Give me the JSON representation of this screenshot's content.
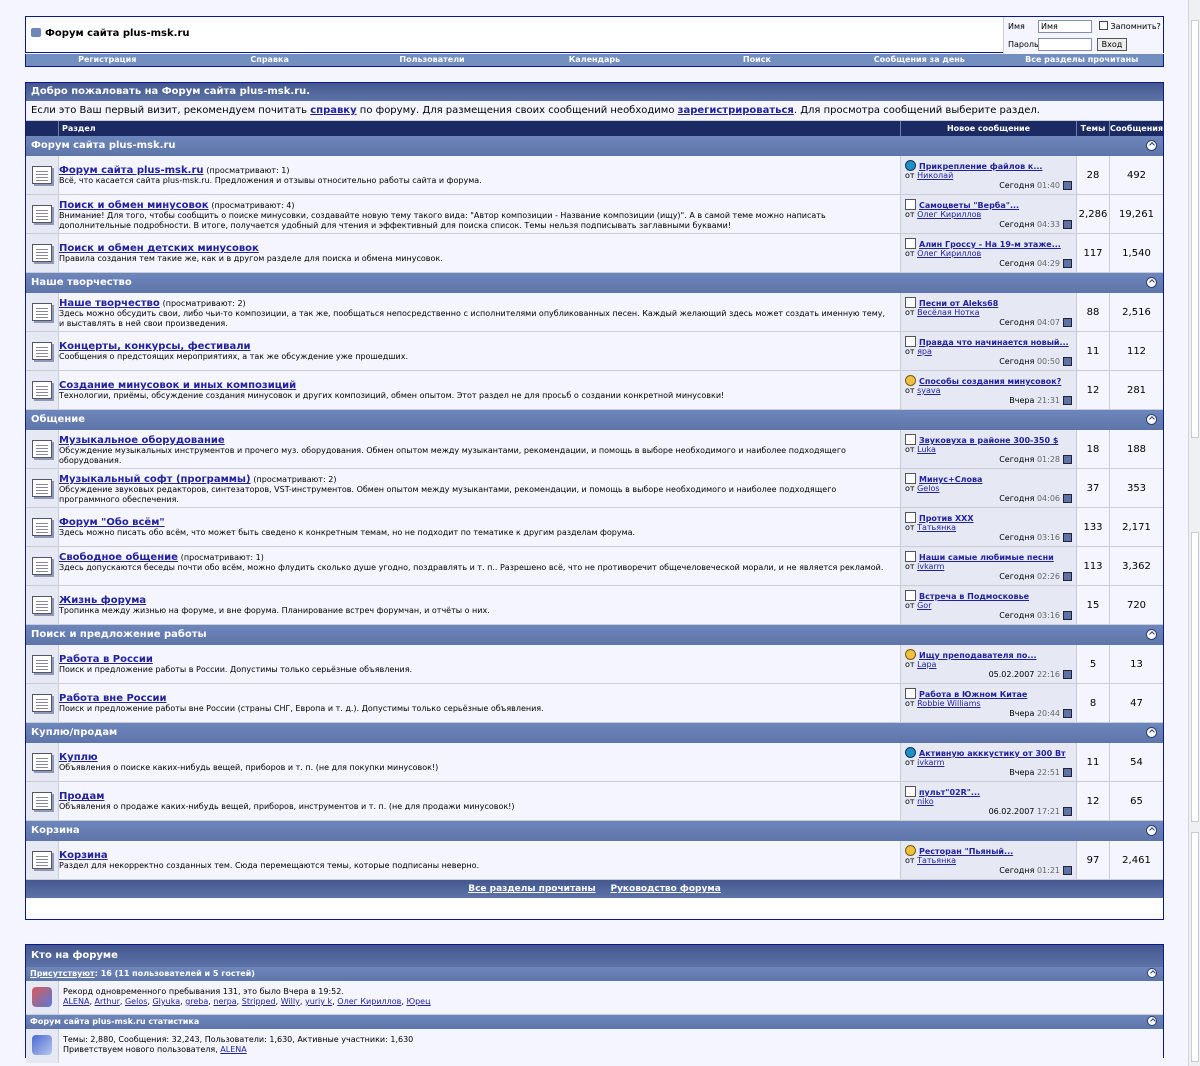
{
  "header": {
    "logo_text": "Форум сайта plus-msk.ru",
    "login": {
      "user_label": "Имя",
      "user_value": "Имя",
      "pass_label": "Пароль",
      "remember_label": "Запомнить?",
      "submit_label": "Вход"
    }
  },
  "navbar": [
    "Регистрация",
    "Справка",
    "Пользователи",
    "Календарь",
    "Поиск",
    "Сообщения за день",
    "Все разделы прочитаны"
  ],
  "welcome": {
    "title": "Добро пожаловать на Форум сайта plus-msk.ru.",
    "text_1": "Если это Ваш первый визит, рекомендуем почитать ",
    "link_help": "справку",
    "text_2": " по форуму. Для размещения своих сообщений необходимо ",
    "link_register": "зарегистрироваться",
    "text_3": ". Для просмотра сообщений выберите раздел."
  },
  "columns": {
    "forum": "Раздел",
    "last": "Новое сообщение",
    "threads": "Темы",
    "posts": "Сообщения"
  },
  "categories": [
    {
      "title": "Форум сайта plus-msk.ru",
      "forums": [
        {
          "name": "Форум сайта plus-msk.ru",
          "viewing": "(просматривают: 1)",
          "desc": "Всё, что касается сайта plus-msk.ru. Предложения и отзывы относительно работы сайта и форума.",
          "last_title": "Прикрепление файлов к...",
          "last_icon": "question",
          "by_label": "от",
          "last_user": "Николай",
          "date": "Сегодня",
          "time": "01:40",
          "threads": "28",
          "posts": "492"
        },
        {
          "name": "Поиск и обмен минусовок",
          "viewing": "(просматривают: 4)",
          "desc": "Внимание! Для того, чтобы сообщить о поиске минусовки, создавайте новую тему такого вида: \"Автор композиции - Название композиции (ищу)\". А в самой теме можно написать дополнительные подробности. В итоге, получается удобный для чтения и эффективный для поиска список. Темы нельзя подписывать заглавными буквами!",
          "last_title": "Самоцветы \"Верба\"...",
          "last_icon": "doc",
          "by_label": "от",
          "last_user": "Олег Кириллов",
          "date": "Сегодня",
          "time": "04:33",
          "threads": "2,286",
          "posts": "19,261"
        },
        {
          "name": "Поиск и обмен детских минусовок",
          "viewing": "",
          "desc": "Правила создания тем такие же, как и в другом разделе для поиска и обмена минусовок.",
          "last_title": "Алин Гроссу - На 19-м этаже...",
          "last_icon": "doc",
          "by_label": "от",
          "last_user": "Олег Кириллов",
          "date": "Сегодня",
          "time": "04:29",
          "threads": "117",
          "posts": "1,540"
        }
      ]
    },
    {
      "title": "Наше творчество",
      "forums": [
        {
          "name": "Наше творчество",
          "viewing": "(просматривают: 2)",
          "desc": "Здесь можно обсудить свои, либо чьи-то композиции, а так же, пообщаться непосредственно с исполнителями опубликованных песен. Каждый желающий здесь может создать именную тему, и выставлять в ней свои произведения.",
          "last_title": "Песни от Aleks68",
          "last_icon": "doc",
          "by_label": "от",
          "last_user": "Весёлая Нотка",
          "date": "Сегодня",
          "time": "04:07",
          "threads": "88",
          "posts": "2,516"
        },
        {
          "name": "Концерты, конкурсы, фестивали",
          "viewing": "",
          "desc": "Сообщения о предстоящих мероприятиях, а так же обсуждение уже прошедших.",
          "last_title": "Правда что начинается новый...",
          "last_icon": "doc",
          "by_label": "от",
          "last_user": "яра",
          "date": "Сегодня",
          "time": "00:50",
          "threads": "11",
          "posts": "112"
        },
        {
          "name": "Создание минусовок и иных композиций",
          "viewing": "",
          "desc": "Технологии, приёмы, обсуждение создания минусовок и других композиций, обмен опытом. Этот раздел не для просьб о создании конкретной минусовки!",
          "last_title": "Способы создания минусовок?",
          "last_icon": "smile",
          "by_label": "от",
          "last_user": "syava",
          "date": "Вчера",
          "time": "21:31",
          "threads": "12",
          "posts": "281"
        }
      ]
    },
    {
      "title": "Общение",
      "forums": [
        {
          "name": "Музыкальное оборудование",
          "viewing": "",
          "desc": "Обсуждение музыкальных инструментов и прочего муз. оборудования. Обмен опытом между музыкантами, рекомендации, и помощь в выборе необходимого и наиболее подходящего оборудования.",
          "last_title": "Звуковуха в районе 300-350 $",
          "last_icon": "doc",
          "by_label": "от",
          "last_user": "Luka",
          "date": "Сегодня",
          "time": "01:28",
          "threads": "18",
          "posts": "188"
        },
        {
          "name": "Музыкальный софт (программы)",
          "viewing": "(просматривают: 2)",
          "desc": "Обсуждение звуковых редакторов, синтезаторов, VST-инструментов. Обмен опытом между музыкантами, рекомендации, и помощь в выборе необходимого и наиболее подходящего программного обеспечения.",
          "last_title": "Минус+Слова",
          "last_icon": "doc",
          "by_label": "от",
          "last_user": "Gelos",
          "date": "Сегодня",
          "time": "04:06",
          "threads": "37",
          "posts": "353"
        },
        {
          "name": "Форум \"Обо всём\"",
          "viewing": "",
          "desc": "Здесь можно писать обо всём, что может быть сведено к конкретным темам, но не подходит по тематике к другим разделам форума.",
          "last_title": "Против XXX",
          "last_icon": "doc",
          "by_label": "от",
          "last_user": "Татьянка",
          "date": "Сегодня",
          "time": "03:16",
          "threads": "133",
          "posts": "2,171"
        },
        {
          "name": "Свободное общение",
          "viewing": "(просматривают: 1)",
          "desc": "Здесь допускаются беседы почти обо всём, можно флудить сколько душе угодно, поздравлять и т. п.. Разрешено всё, что не противоречит общечеловеческой морали, и не является рекламой.",
          "last_title": "Наши самые любимые песни",
          "last_icon": "doc",
          "by_label": "от",
          "last_user": "ivkarm",
          "date": "Сегодня",
          "time": "02:26",
          "threads": "113",
          "posts": "3,362"
        },
        {
          "name": "Жизнь форума",
          "viewing": "",
          "desc": "Тропинка между жизнью на форуме, и вне форума. Планирование встреч форумчан, и отчёты о них.",
          "last_title": "Встреча в Подмосковье",
          "last_icon": "doc",
          "by_label": "от",
          "last_user": "Gor",
          "date": "Сегодня",
          "time": "03:16",
          "threads": "15",
          "posts": "720"
        }
      ]
    },
    {
      "title": "Поиск и предложение работы",
      "forums": [
        {
          "name": "Работа в России",
          "viewing": "",
          "desc": "Поиск и предложение работы в России. Допустимы только серьёзные объявления.",
          "last_title": "Ищу преподавателя по...",
          "last_icon": "smile",
          "by_label": "от",
          "last_user": "Lapa",
          "date": "05.02.2007",
          "time": "22:16",
          "threads": "5",
          "posts": "13"
        },
        {
          "name": "Работа вне России",
          "viewing": "",
          "desc": "Поиск и предложение работы вне России (страны СНГ, Европа и т. д.). Допустимы только серьёзные объявления.",
          "last_title": "Работа в Южном Китае",
          "last_icon": "doc",
          "by_label": "от",
          "last_user": "Robbie Williams",
          "date": "Вчера",
          "time": "20:44",
          "threads": "8",
          "posts": "47"
        }
      ]
    },
    {
      "title": "Куплю/продам",
      "forums": [
        {
          "name": "Куплю",
          "viewing": "",
          "desc": "Объявления о поиске каких-нибудь вещей, приборов и т. п. (не для покупки минусовок!)",
          "last_title": "Активную акккустику от 300 Вт",
          "last_icon": "question",
          "by_label": "от",
          "last_user": "ivkarm",
          "date": "Вчера",
          "time": "22:51",
          "threads": "11",
          "posts": "54"
        },
        {
          "name": "Продам",
          "viewing": "",
          "desc": "Объявления о продаже каких-нибудь вещей, приборов, инструментов и т. п. (не для продажи минусовок!)",
          "last_title": "пульт\"02R\"...",
          "last_icon": "doc",
          "by_label": "от",
          "last_user": "niko",
          "date": "06.02.2007",
          "time": "17:21",
          "threads": "12",
          "posts": "65"
        }
      ]
    },
    {
      "title": "Корзина",
      "forums": [
        {
          "name": "Корзина",
          "viewing": "",
          "desc": "Раздел для некорректно созданных тем. Сюда перемещаются темы, которые подписаны неверно.",
          "last_title": "Ресторан \"Пьяный...",
          "last_icon": "smile",
          "by_label": "от",
          "last_user": "Татьянка",
          "date": "Сегодня",
          "time": "01:21",
          "threads": "97",
          "posts": "2,461"
        }
      ]
    }
  ],
  "footer_links": [
    "Все разделы прочитаны",
    "Руководство форума"
  ],
  "who": {
    "title": "Кто на форуме",
    "present_label": "Присутствуют",
    "present_text": ": 16 (11 пользователей и 5 гостей)",
    "record_text": "Рекорд одновременного пребывания 131, это было Вчера в 19:52.",
    "users": [
      "ALENA",
      "Arthur",
      "Gelos",
      "Glyuka",
      "greba",
      "nerpa",
      "Stripped",
      "Willy",
      "yuriy k",
      "Олег Кириллов",
      "Юрец"
    ],
    "stats_title": "Форум сайта plus-msk.ru статистика",
    "stats_text": "Темы: 2,880, Сообщения: 32,243, Пользователи: 1,630, Активные участники: 1,630",
    "welcome_new": "Приветствуем нового пользователя, ",
    "new_user": "ALENA"
  },
  "colors": {
    "border": "#0b198c",
    "header_dark": "#1b2a63",
    "category_bar": "#6d86bb",
    "row_light": "#f5f5ff",
    "row_alt": "#e6e9f4",
    "link": "#22229c"
  }
}
